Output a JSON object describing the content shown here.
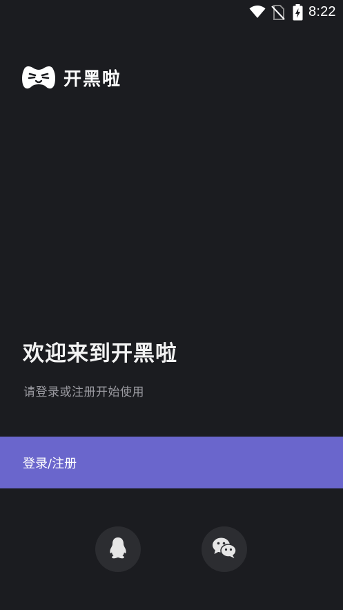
{
  "status_bar": {
    "time": "8:22",
    "icons": [
      "wifi-icon",
      "no-sim-icon",
      "battery-charging-icon"
    ]
  },
  "brand": {
    "logo_icon": "gamepad-face-logo-icon",
    "name": "开黑啦"
  },
  "welcome": {
    "title": "欢迎来到开黑啦",
    "subtitle": "请登录或注册开始使用"
  },
  "login": {
    "label": "登录/注册"
  },
  "social_login": [
    {
      "icon": "qq-penguin-icon"
    },
    {
      "icon": "wechat-icon"
    }
  ],
  "colors": {
    "background": "#1b1c20",
    "accent": "#6a66cc",
    "social_button_bg": "#2c2d31",
    "subtitle_text": "#9a9aa0"
  }
}
